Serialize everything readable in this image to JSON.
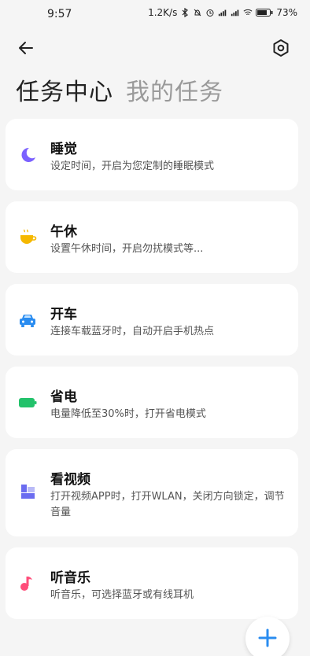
{
  "status_bar": {
    "time": "9:57",
    "network_speed": "1.2K/s",
    "battery": "73%"
  },
  "header": {
    "tab_active": "任务中心",
    "tab_inactive": "我的任务"
  },
  "cards": [
    {
      "title": "睡觉",
      "desc": "设定时间，开启为您定制的睡眠模式",
      "icon": "moon-icon",
      "icon_color": "#7b61ff"
    },
    {
      "title": "午休",
      "desc": "设置午休时间，开启勿扰模式等...",
      "icon": "coffee-cup-icon",
      "icon_color": "#f5b800"
    },
    {
      "title": "开车",
      "desc": "连接车载蓝牙时，自动开启手机热点",
      "icon": "car-icon",
      "icon_color": "#2a8cf0"
    },
    {
      "title": "省电",
      "desc": "电量降低至30%时，打开省电模式",
      "icon": "battery-icon",
      "icon_color": "#23c26b"
    },
    {
      "title": "看视频",
      "desc": "打开视频APP时，打开WLAN，关闭方向锁定，调节音量",
      "icon": "video-icon",
      "icon_color": "#6b6cf0"
    },
    {
      "title": "听音乐",
      "desc": "听音乐，可选择蓝牙或有线耳机",
      "icon": "music-note-icon",
      "icon_color": "#ff4d7a"
    }
  ],
  "colors": {
    "accent": "#2a8cf0",
    "background": "#f5f5f5",
    "card": "#ffffff"
  }
}
